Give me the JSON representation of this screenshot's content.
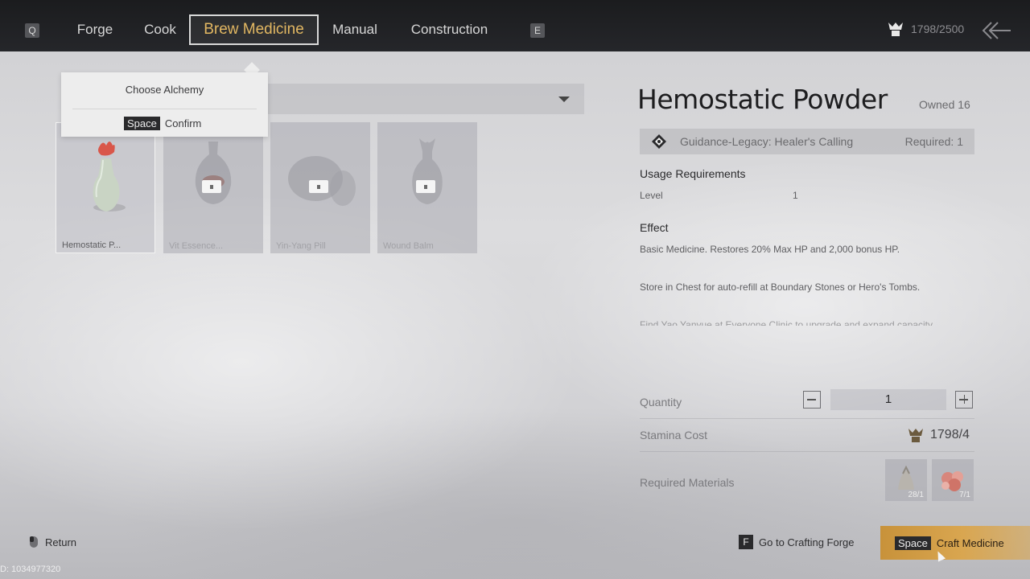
{
  "topbar": {
    "left_key": "Q",
    "right_key": "E",
    "tabs": [
      {
        "label": "Forge"
      },
      {
        "label": "Cook"
      },
      {
        "label": "Brew Medicine"
      },
      {
        "label": "Manual"
      },
      {
        "label": "Construction"
      }
    ],
    "stamina": "1798/2500"
  },
  "popup": {
    "title": "Choose Alchemy",
    "key": "Space",
    "action": "Confirm"
  },
  "recipes": [
    {
      "name": "Hemostatic P...",
      "selected": true,
      "locked": false
    },
    {
      "name": "Vit Essence...",
      "selected": false,
      "locked": true
    },
    {
      "name": "Yin-Yang Pill",
      "selected": false,
      "locked": true
    },
    {
      "name": "Wound Balm",
      "selected": false,
      "locked": true
    }
  ],
  "detail": {
    "title": "Hemostatic Powder",
    "owned": "Owned 16",
    "legacy_name": "Guidance-Legacy: Healer's Calling",
    "legacy_required": "Required: 1",
    "usage_heading": "Usage Requirements",
    "level_label": "Level",
    "level_value": "1",
    "effect_heading": "Effect",
    "effect_line1": "Basic Medicine. Restores 20% Max HP and 2,000 bonus HP.",
    "effect_line2": "Store in Chest for auto-refill at Boundary Stones or Hero's Tombs.",
    "effect_line3": "Find Yao Yanyue at Everyone Clinic to upgrade and expand capacity."
  },
  "crafting": {
    "quantity_label": "Quantity",
    "quantity_value": "1",
    "stamina_label": "Stamina Cost",
    "stamina_value": "1798/4",
    "materials_label": "Required Materials",
    "materials": [
      {
        "count": "28/1",
        "color": "#b8b4ad"
      },
      {
        "count": "7/1",
        "color": "#d8867c"
      }
    ]
  },
  "bottom": {
    "return_label": "Return",
    "uid": "D: 1034977320",
    "forge_key": "F",
    "forge_label": "Go to Crafting Forge",
    "craft_key": "Space",
    "craft_label": "Craft Medicine"
  },
  "colors": {
    "accent": "#e2b762",
    "craft_button": "#d9a650"
  }
}
